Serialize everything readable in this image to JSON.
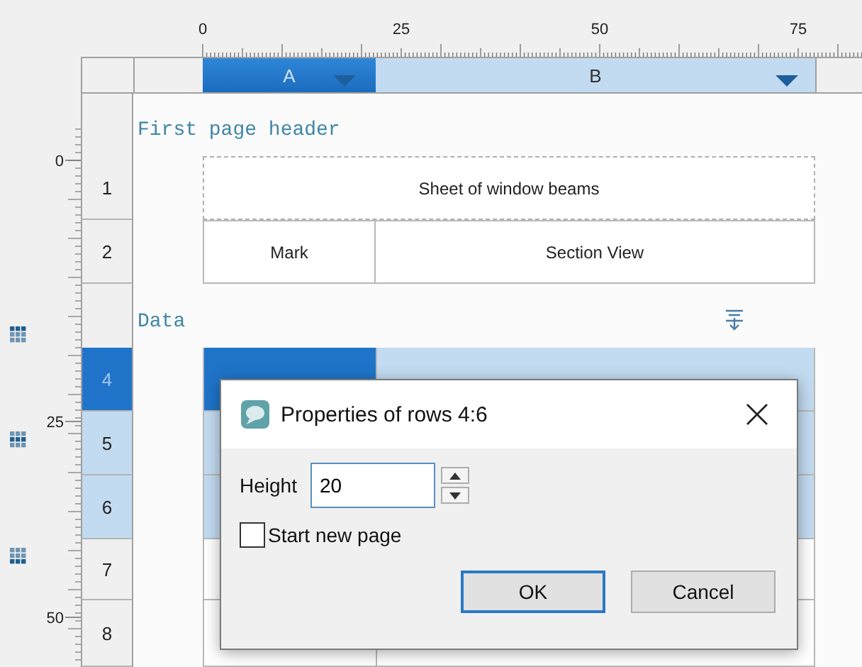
{
  "rulers": {
    "top_labels": [
      "0",
      "25",
      "50",
      "75"
    ],
    "left_labels": [
      "0",
      "25",
      "50"
    ]
  },
  "columns": [
    {
      "label": "A",
      "active": true
    },
    {
      "label": "B",
      "active": false
    }
  ],
  "bands": [
    {
      "kind": "header",
      "title": "First page header",
      "rows": [
        {
          "number": "1",
          "kind": "merged",
          "selected": false,
          "active": false,
          "cells": [
            {
              "text": "Sheet of window beams"
            }
          ]
        },
        {
          "number": "2",
          "kind": "split",
          "selected": false,
          "active": false,
          "cells": [
            {
              "text": "Mark"
            },
            {
              "text": "Section View"
            }
          ]
        }
      ]
    },
    {
      "kind": "data",
      "title": "Data",
      "rows": [
        {
          "number": "4",
          "selected": true,
          "active": true,
          "cells": [
            {},
            {}
          ]
        },
        {
          "number": "5",
          "selected": true,
          "active": false,
          "cells": [
            {},
            {}
          ]
        },
        {
          "number": "6",
          "selected": true,
          "active": false,
          "cells": [
            {},
            {}
          ]
        },
        {
          "number": "7",
          "selected": false,
          "active": false,
          "cells": [
            {},
            {}
          ]
        },
        {
          "number": "8",
          "selected": false,
          "active": false,
          "cells": [
            {},
            {}
          ]
        }
      ]
    }
  ],
  "dialog": {
    "title": "Properties of rows 4:6",
    "height_label": "Height",
    "height_value": "20",
    "checkbox": {
      "label": "Start new page",
      "checked": false
    },
    "buttons": [
      {
        "label": "OK",
        "default": true
      },
      {
        "label": "Cancel",
        "default": false
      }
    ]
  }
}
